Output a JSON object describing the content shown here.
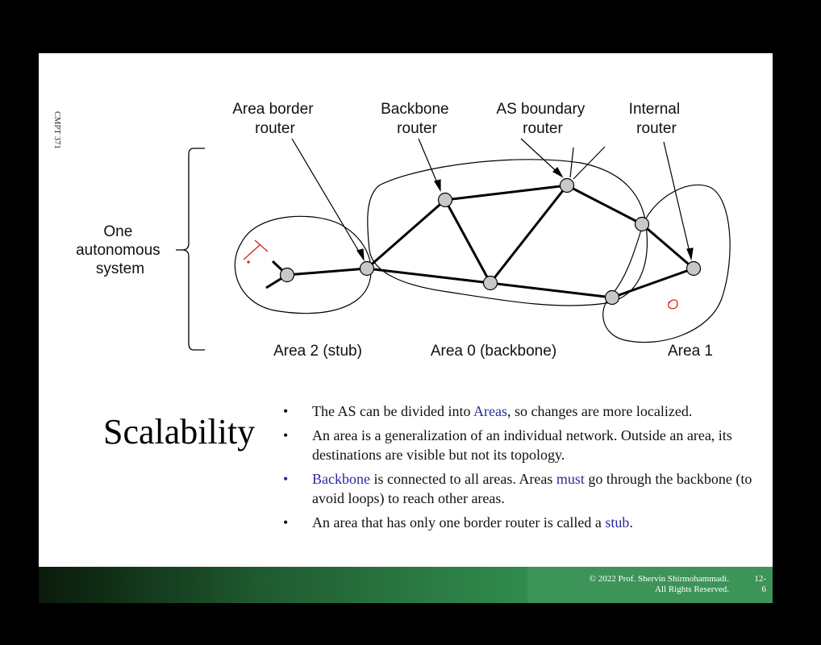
{
  "slide": {
    "course_label": "CMPT 371",
    "title": "Scalability",
    "bullets": [
      {
        "parts": [
          {
            "t": "The AS can be divided into "
          },
          {
            "t": "Areas",
            "hl": true
          },
          {
            "t": ", so changes are more localized."
          }
        ]
      },
      {
        "parts": [
          {
            "t": "An area is a generalization of an individual network. Outside an area, its destinations are visible but not its topology."
          }
        ]
      },
      {
        "parts": [
          {
            "t": "Backbone",
            "hl": true
          },
          {
            "t": " is connected to all areas. Areas "
          },
          {
            "t": "must",
            "hl": true
          },
          {
            "t": " go through the backbone (to avoid loops) to reach other areas."
          }
        ],
        "blue_bullet": true
      },
      {
        "parts": [
          {
            "t": "An area that has only one border router is called a "
          },
          {
            "t": "stub",
            "hl": true
          },
          {
            "t": "."
          }
        ]
      }
    ],
    "bullet_char": "•",
    "footer": {
      "copyright": "© 2022 Prof. Shervin Shirmohammadi.\nAll Rights Reserved.",
      "page": "12-\n6"
    }
  },
  "diagram": {
    "labels": {
      "area_border_router": [
        "Area border",
        "router"
      ],
      "backbone_router": [
        "Backbone",
        "router"
      ],
      "as_boundary_router": [
        "AS boundary",
        "router"
      ],
      "internal_router": [
        "Internal",
        "router"
      ],
      "one_as": [
        "One",
        "autonomous",
        "system"
      ],
      "area2": "Area 2 (stub)",
      "area0": "Area 0 (backbone)",
      "area1": "Area 1"
    },
    "colors": {
      "router_fill": "#c8c8c8",
      "line": "#000000",
      "annotation": "#d42020",
      "highlight": "#2a2a9a"
    }
  }
}
